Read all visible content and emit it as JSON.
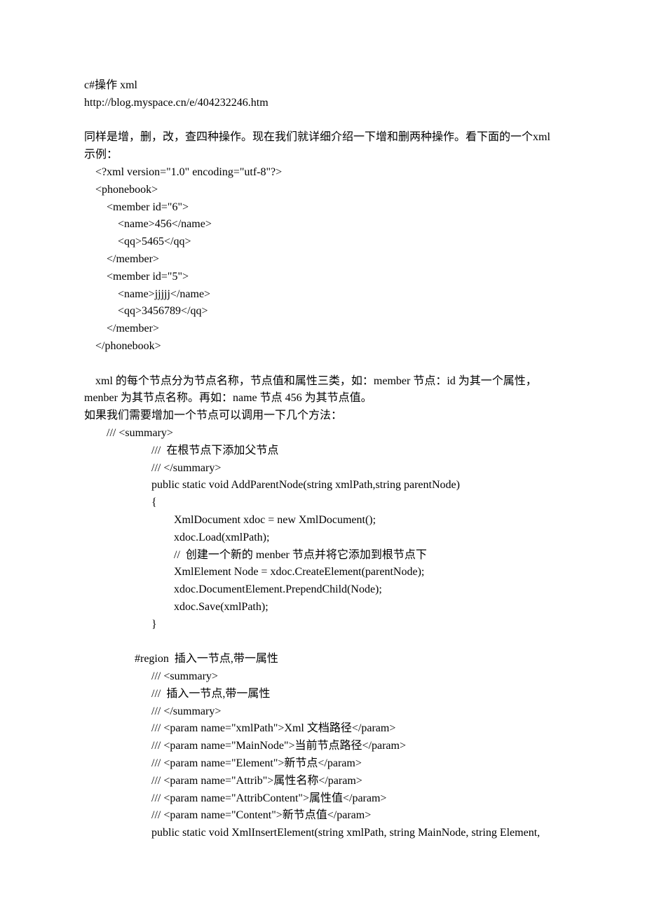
{
  "title": "c#操作 xml",
  "url": "http://blog.myspace.cn/e/404232246.htm",
  "intro": "同样是增，删，改，查四种操作。现在我们就详细介绍一下增和删两种操作。看下面的一个xml 示例：",
  "xml": {
    "decl": "<?xml version=\"1.0\" encoding=\"utf-8\"?>",
    "root_open": "<phonebook>",
    "m1_open": "<member id=\"6\">",
    "m1_name": "<name>456</name>",
    "m1_qq": "<qq>5465</qq>",
    "m1_close": "</member>",
    "m2_open": "<member id=\"5\">",
    "m2_name": "<name>jjjjj</name>",
    "m2_qq": "<qq>3456789</qq>",
    "m2_close": "</member>",
    "root_close": "</phonebook>"
  },
  "explain1": "    xml 的每个节点分为节点名称，节点值和属性三类，如：member 节点：id 为其一个属性，menber 为其节点名称。再如：name 节点 456 为其节点值。",
  "explain2": "如果我们需要增加一个节点可以调用一下几个方法：",
  "code1": {
    "l1": "/// <summary>",
    "l2": "///  在根节点下添加父节点",
    "l3": "/// </summary>",
    "l4": "public static void AddParentNode(string xmlPath,string parentNode)",
    "l5": "{",
    "l6": "XmlDocument xdoc = new XmlDocument();",
    "l7": "xdoc.Load(xmlPath);",
    "l8": "//  创建一个新的 menber 节点并将它添加到根节点下",
    "l9": "XmlElement Node = xdoc.CreateElement(parentNode);",
    "l10": "xdoc.DocumentElement.PrependChild(Node);",
    "l11": "xdoc.Save(xmlPath);",
    "l12": "}"
  },
  "code2": {
    "region": "#region  插入一节点,带一属性",
    "l1": "/// <summary>",
    "l2": "///  插入一节点,带一属性",
    "l3": "/// </summary>",
    "l4": "/// <param name=\"xmlPath\">Xml 文档路径</param>",
    "l5": "/// <param name=\"MainNode\">当前节点路径</param>",
    "l6": "/// <param name=\"Element\">新节点</param>",
    "l7": "/// <param name=\"Attrib\">属性名称</param>",
    "l8": "/// <param name=\"AttribContent\">属性值</param>",
    "l9": "/// <param name=\"Content\">新节点值</param>",
    "l10": "public static void XmlInsertElement(string xmlPath, string MainNode, string Element,"
  }
}
